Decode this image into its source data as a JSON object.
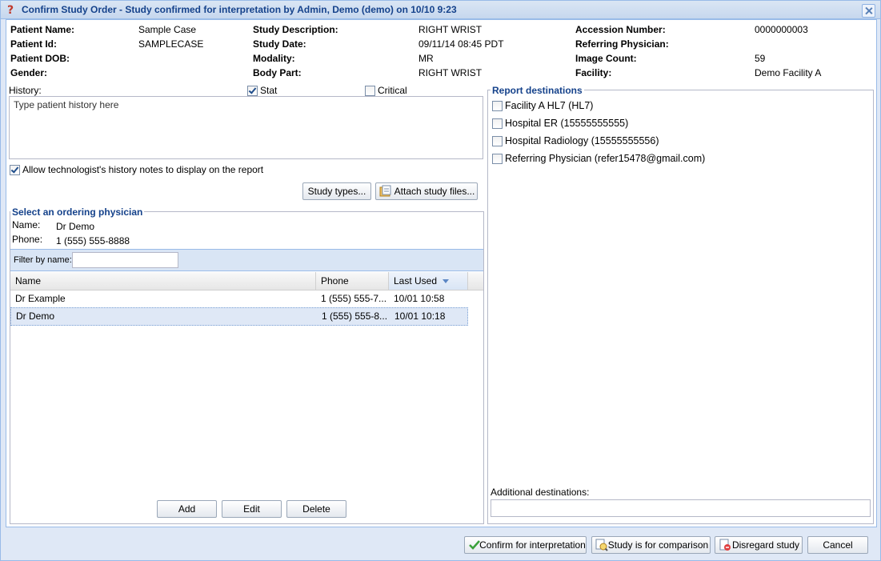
{
  "window": {
    "title": "Confirm Study Order - Study confirmed for interpretation by Admin, Demo (demo) on 10/10 9:23"
  },
  "patient": {
    "col1": [
      {
        "label": "Patient Name:",
        "value": "Sample Case"
      },
      {
        "label": "Patient Id:",
        "value": "SAMPLECASE"
      },
      {
        "label": "Patient DOB:",
        "value": ""
      },
      {
        "label": "Gender:",
        "value": ""
      }
    ],
    "col2": [
      {
        "label": "Study Description:",
        "value": "RIGHT WRIST"
      },
      {
        "label": "Study Date:",
        "value": "09/11/14 08:45 PDT"
      },
      {
        "label": "Modality:",
        "value": "MR"
      },
      {
        "label": "Body Part:",
        "value": "RIGHT WRIST"
      }
    ],
    "col3": [
      {
        "label": "Accession Number:",
        "value": "0000000003"
      },
      {
        "label": "Referring Physician:",
        "value": ""
      },
      {
        "label": "Image Count:",
        "value": "59"
      },
      {
        "label": "Facility:",
        "value": "Demo Facility A"
      }
    ]
  },
  "history": {
    "label": "History:",
    "stat_label": "Stat",
    "stat_checked": true,
    "critical_label": "Critical",
    "critical_checked": false,
    "placeholder": "Type patient history here",
    "allow_tech_label": "Allow technologist's history notes to display on the report",
    "allow_tech_checked": true
  },
  "buttons": {
    "study_types": "Study types...",
    "attach_files": "Attach study files...",
    "add": "Add",
    "edit": "Edit",
    "delete": "Delete",
    "confirm": "Confirm for interpretation",
    "comparison": "Study is for comparison",
    "disregard": "Disregard study",
    "cancel": "Cancel"
  },
  "physician": {
    "legend": "Select an ordering physician",
    "name_label": "Name:",
    "name_value": "Dr Demo",
    "phone_label": "Phone:",
    "phone_value": "1 (555) 555-8888",
    "filter_label": "Filter by name:",
    "filter_value": "",
    "columns": {
      "name": "Name",
      "phone": "Phone",
      "last_used": "Last Used"
    },
    "rows": [
      {
        "name": "Dr Example",
        "phone": "1 (555) 555-7...",
        "last_used": "10/01 10:58",
        "selected": false
      },
      {
        "name": "Dr Demo",
        "phone": "1 (555) 555-8...",
        "last_used": "10/01 10:18",
        "selected": true
      }
    ]
  },
  "destinations": {
    "legend": "Report destinations",
    "items": [
      {
        "label": "Facility A HL7 (HL7)",
        "checked": false
      },
      {
        "label": "Hospital ER (15555555555)",
        "checked": false
      },
      {
        "label": "Hospital Radiology (15555555556)",
        "checked": false
      },
      {
        "label": "Referring Physician (refer15478@gmail.com)",
        "checked": false
      }
    ],
    "additional_label": "Additional destinations:",
    "additional_value": ""
  }
}
